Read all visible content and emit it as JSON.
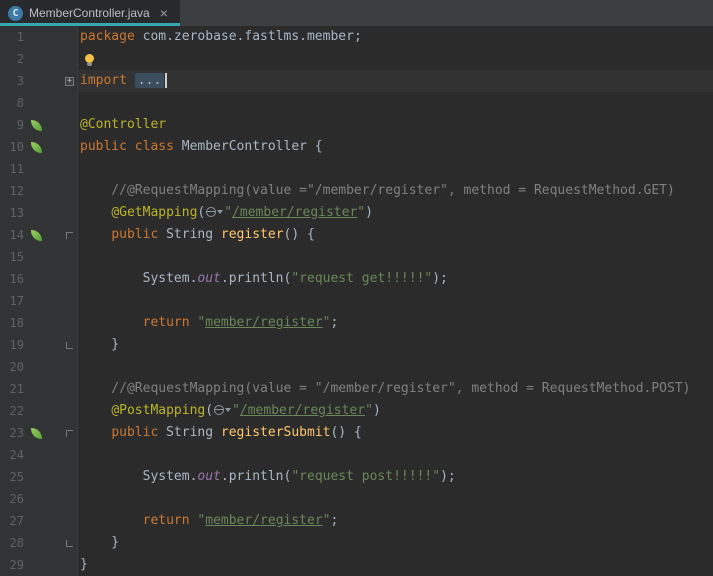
{
  "tab": {
    "title": "MemberController.java"
  },
  "icons": {
    "tab_close": "×",
    "java_class_letter": "C",
    "fold_collapsed": "+"
  },
  "colors": {
    "editor_bg": "#2b2b2b",
    "gutter_bg": "#313335",
    "gutter_border": "#3a3d3f",
    "tab_bar_bg": "#3c3f41",
    "tab_bg": "#27292c",
    "tab_accent": "#3aa6b2",
    "tab_label": "#bcbec0",
    "line_number": "#606366",
    "keyword": "#cc7832",
    "default_text": "#a9b7c6",
    "string": "#6a8759",
    "comment": "#808080",
    "annotation": "#bbb529",
    "method_decl": "#ffc66b",
    "instance_field": "#9876aa",
    "folded_bg": "#3c4d5d",
    "caret": "#d0d0d0",
    "current_line_bg": "#323232",
    "spring_green": "#77b25a",
    "bulb_yellow": "#f2c249",
    "java_icon_blue": "#3d7ba6",
    "fold_marker": "#767a7c",
    "endpoint_icon": "#8a99a3"
  },
  "editor": {
    "current_line": 3,
    "lines": [
      {
        "num": 1,
        "segments": [
          {
            "text": "package ",
            "style": "kw"
          },
          {
            "text": "com.zerobase.fastlms.member;",
            "style": "def"
          }
        ]
      },
      {
        "num": 2,
        "segments": [
          {
            "icon": "bulb"
          }
        ]
      },
      {
        "num": 3,
        "fold": "collapsed",
        "segments": [
          {
            "text": "import ",
            "style": "kw"
          },
          {
            "text": "...",
            "style": "folded"
          },
          {
            "caret": true
          }
        ]
      },
      {
        "num": 8,
        "segments": []
      },
      {
        "num": 9,
        "gutter_icon": "spring",
        "segments": [
          {
            "text": "@Controller",
            "style": "ann"
          }
        ]
      },
      {
        "num": 10,
        "gutter_icon": "spring",
        "segments": [
          {
            "text": "public class ",
            "style": "kw"
          },
          {
            "text": "MemberController {",
            "style": "def"
          }
        ]
      },
      {
        "num": 11,
        "segments": []
      },
      {
        "num": 12,
        "segments": [
          {
            "text": "    //@RequestMapping(value =\"/member/register\", method = RequestMethod.GET)",
            "style": "com"
          }
        ]
      },
      {
        "num": 13,
        "segments": [
          {
            "text": "    ",
            "style": "def"
          },
          {
            "text": "@GetMapping",
            "style": "ann"
          },
          {
            "text": "(",
            "style": "def"
          },
          {
            "icon": "endpoint"
          },
          {
            "text": "\"",
            "style": "str"
          },
          {
            "text": "/member/register",
            "style": "strlink"
          },
          {
            "text": "\"",
            "style": "str"
          },
          {
            "text": ")",
            "style": "def"
          }
        ]
      },
      {
        "num": 14,
        "gutter_icon": "spring",
        "fold": "top",
        "segments": [
          {
            "text": "    ",
            "style": "def"
          },
          {
            "text": "public ",
            "style": "kw"
          },
          {
            "text": "String ",
            "style": "def"
          },
          {
            "text": "register",
            "style": "method"
          },
          {
            "text": "() {",
            "style": "def"
          }
        ]
      },
      {
        "num": 15,
        "segments": []
      },
      {
        "num": 16,
        "segments": [
          {
            "text": "        System.",
            "style": "def"
          },
          {
            "text": "out",
            "style": "field"
          },
          {
            "text": ".println(",
            "style": "def"
          },
          {
            "text": "\"request get!!!!!\"",
            "style": "str"
          },
          {
            "text": ");",
            "style": "def"
          }
        ]
      },
      {
        "num": 17,
        "segments": []
      },
      {
        "num": 18,
        "segments": [
          {
            "text": "        ",
            "style": "def"
          },
          {
            "text": "return ",
            "style": "kw"
          },
          {
            "text": "\"",
            "style": "str"
          },
          {
            "text": "member/register",
            "style": "strlink"
          },
          {
            "text": "\"",
            "style": "str"
          },
          {
            "text": ";",
            "style": "def"
          }
        ]
      },
      {
        "num": 19,
        "fold": "bottom",
        "segments": [
          {
            "text": "    }",
            "style": "def"
          }
        ]
      },
      {
        "num": 20,
        "segments": []
      },
      {
        "num": 21,
        "segments": [
          {
            "text": "    //@RequestMapping(value = \"/member/register\", method = RequestMethod.POST)",
            "style": "com"
          }
        ]
      },
      {
        "num": 22,
        "segments": [
          {
            "text": "    ",
            "style": "def"
          },
          {
            "text": "@PostMapping",
            "style": "ann"
          },
          {
            "text": "(",
            "style": "def"
          },
          {
            "icon": "endpoint"
          },
          {
            "text": "\"",
            "style": "str"
          },
          {
            "text": "/member/register",
            "style": "strlink"
          },
          {
            "text": "\"",
            "style": "str"
          },
          {
            "text": ")",
            "style": "def"
          }
        ]
      },
      {
        "num": 23,
        "gutter_icon": "spring",
        "fold": "top",
        "segments": [
          {
            "text": "    ",
            "style": "def"
          },
          {
            "text": "public ",
            "style": "kw"
          },
          {
            "text": "String ",
            "style": "def"
          },
          {
            "text": "registerSubmit",
            "style": "method"
          },
          {
            "text": "() {",
            "style": "def"
          }
        ]
      },
      {
        "num": 24,
        "segments": []
      },
      {
        "num": 25,
        "segments": [
          {
            "text": "        System.",
            "style": "def"
          },
          {
            "text": "out",
            "style": "field"
          },
          {
            "text": ".println(",
            "style": "def"
          },
          {
            "text": "\"request post!!!!!\"",
            "style": "str"
          },
          {
            "text": ");",
            "style": "def"
          }
        ]
      },
      {
        "num": 26,
        "segments": []
      },
      {
        "num": 27,
        "segments": [
          {
            "text": "        ",
            "style": "def"
          },
          {
            "text": "return ",
            "style": "kw"
          },
          {
            "text": "\"",
            "style": "str"
          },
          {
            "text": "member/register",
            "style": "strlink"
          },
          {
            "text": "\"",
            "style": "str"
          },
          {
            "text": ";",
            "style": "def"
          }
        ]
      },
      {
        "num": 28,
        "fold": "bottom",
        "segments": [
          {
            "text": "    }",
            "style": "def"
          }
        ]
      },
      {
        "num": 29,
        "segments": [
          {
            "text": "}",
            "style": "def"
          }
        ]
      }
    ]
  }
}
